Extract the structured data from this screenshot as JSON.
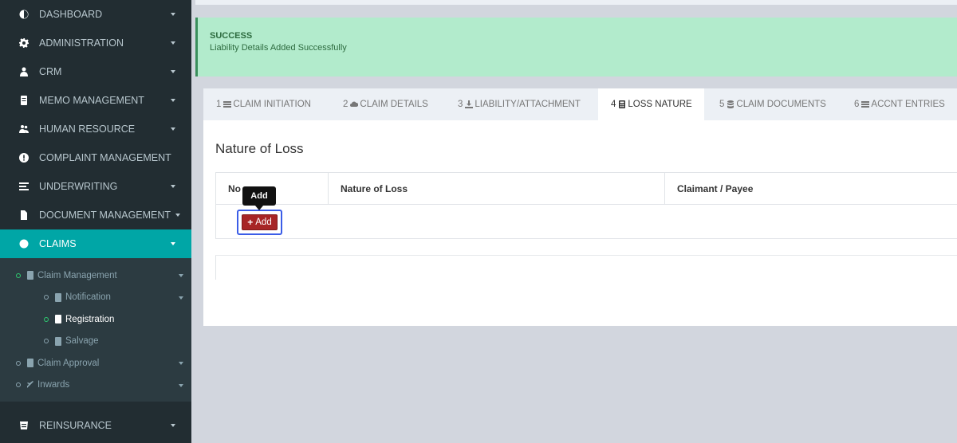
{
  "sidebar": {
    "items": [
      {
        "label": "DASHBOARD",
        "icon": "dashboard-icon"
      },
      {
        "label": "ADMINISTRATION",
        "icon": "cog-icon"
      },
      {
        "label": "CRM",
        "icon": "user-icon"
      },
      {
        "label": "MEMO MANAGEMENT",
        "icon": "memo-icon"
      },
      {
        "label": "HUMAN RESOURCE",
        "icon": "users-icon"
      },
      {
        "label": "COMPLAINT MANAGEMENT",
        "icon": "alert-icon"
      },
      {
        "label": "UNDERWRITING",
        "icon": "list-icon"
      },
      {
        "label": "DOCUMENT MANAGEMENT",
        "icon": "file-icon"
      },
      {
        "label": "CLAIMS",
        "icon": "claims-icon"
      }
    ],
    "claims_tree": {
      "claim_management": "Claim Management",
      "notification": "Notification",
      "registration": "Registration",
      "salvage": "Salvage",
      "claim_approval": "Claim Approval",
      "inwards": "Inwards"
    },
    "reinsurance": "REINSURANCE"
  },
  "alert": {
    "title": "SUCCESS",
    "message": "Liability Details Added Successfully"
  },
  "tabs": [
    {
      "num": "1",
      "label": "CLAIM INITIATION",
      "icon": "bars-icon"
    },
    {
      "num": "2",
      "label": "CLAIM DETAILS",
      "icon": "cloud-icon"
    },
    {
      "num": "3",
      "label": "LIABILITY/ATTACHMENT",
      "icon": "download-icon"
    },
    {
      "num": "4",
      "label": "LOSS NATURE",
      "icon": "calculator-icon"
    },
    {
      "num": "5",
      "label": "CLAIM DOCUMENTS",
      "icon": "database-icon"
    },
    {
      "num": "6",
      "label": "ACCNT ENTRIES",
      "icon": "bars-icon"
    }
  ],
  "panel": {
    "title": "Nature of Loss",
    "columns": [
      "No",
      "Nature of Loss",
      "Claimant / Payee"
    ],
    "add_label": "Add",
    "tooltip": "Add"
  },
  "colors": {
    "sidebar_bg": "#222d32",
    "active_teal": "#00a6a6",
    "success_bg": "#b2ebcc",
    "add_red": "#a72525"
  }
}
